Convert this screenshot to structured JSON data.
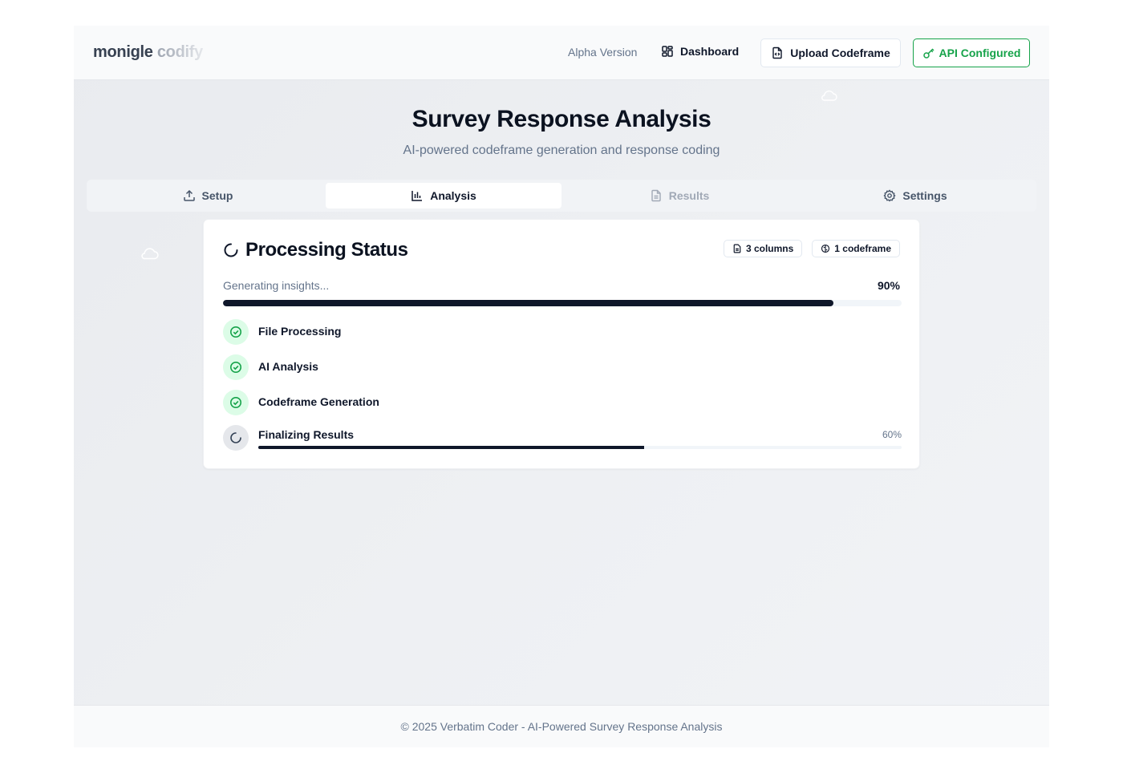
{
  "header": {
    "logo_primary": "monigle",
    "logo_secondary": "codify",
    "version_label": "Alpha Version",
    "dashboard_label": "Dashboard",
    "upload_label": "Upload Codeframe",
    "api_label": "API Configured",
    "api_color": "#16a34a"
  },
  "page": {
    "title": "Survey Response Analysis",
    "subtitle": "AI-powered codeframe generation and response coding"
  },
  "tabs": [
    {
      "label": "Setup",
      "icon": "upload-icon",
      "state": "normal"
    },
    {
      "label": "Analysis",
      "icon": "bar-chart-icon",
      "state": "active"
    },
    {
      "label": "Results",
      "icon": "file-text-icon",
      "state": "disabled"
    },
    {
      "label": "Settings",
      "icon": "gear-icon",
      "state": "normal"
    }
  ],
  "status": {
    "title": "Processing Status",
    "badges": [
      {
        "label": "3 columns",
        "icon": "file-icon"
      },
      {
        "label": "1 codeframe",
        "icon": "brain-icon"
      }
    ],
    "progress_label": "Generating insights...",
    "progress_text": "90%",
    "progress_value": 0.9,
    "steps": [
      {
        "label": "File Processing",
        "state": "complete"
      },
      {
        "label": "AI Analysis",
        "state": "complete"
      },
      {
        "label": "Codeframe Generation",
        "state": "complete"
      },
      {
        "label": "Finalizing Results",
        "state": "in-progress",
        "progress_text": "60%",
        "progress_value": 0.6
      }
    ]
  },
  "footer": {
    "text": "© 2025 Verbatim Coder - AI-Powered Survey Response Analysis"
  },
  "colors": {
    "accent_dark": "#0f172a",
    "success": "#16a34a",
    "success_bg": "#dcfce7"
  }
}
